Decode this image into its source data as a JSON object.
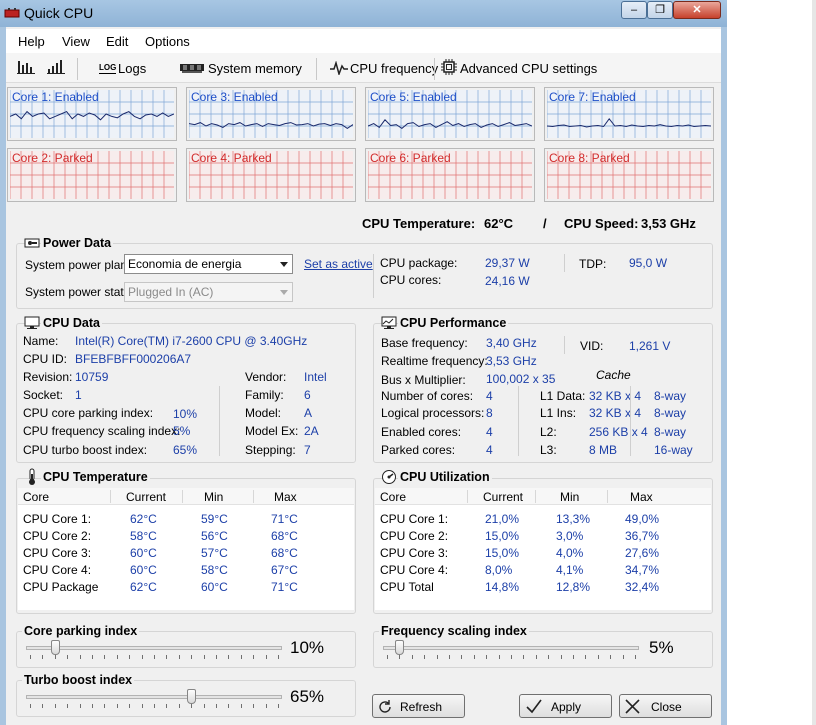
{
  "window": {
    "title": "Quick CPU",
    "controls": {
      "minimize": "‒",
      "maximize": "❐",
      "close": "✕"
    }
  },
  "menu": [
    "Help",
    "View",
    "Edit",
    "Options"
  ],
  "toolbar": {
    "logs": "Logs",
    "system_memory": "System memory",
    "cpu_frequency": "CPU frequency",
    "advanced": "Advanced CPU settings",
    "logs_icon_text": "LOG"
  },
  "cores": [
    {
      "label": "Core 1: Enabled",
      "state": "enabled",
      "series": [
        0.55,
        0.5,
        0.6,
        0.45,
        0.55,
        0.5,
        0.48,
        0.6,
        0.55,
        0.5,
        0.45,
        0.6,
        0.5,
        0.55,
        0.48,
        0.52,
        0.62,
        0.5,
        0.55,
        0.58,
        0.5,
        0.45,
        0.55,
        0.6,
        0.52,
        0.5,
        0.55,
        0.48,
        0.55,
        0.5
      ]
    },
    {
      "label": "Core 3: Enabled",
      "state": "enabled",
      "series": [
        0.7,
        0.72,
        0.68,
        0.75,
        0.7,
        0.73,
        0.78,
        0.7,
        0.72,
        0.68,
        0.75,
        0.72,
        0.7,
        0.76,
        0.7,
        0.72,
        0.74,
        0.7,
        0.68,
        0.73,
        0.72,
        0.7,
        0.75,
        0.71,
        0.7,
        0.74,
        0.7,
        0.72,
        0.8,
        0.72
      ]
    },
    {
      "label": "Core 5: Enabled",
      "state": "enabled",
      "series": [
        0.75,
        0.7,
        0.78,
        0.62,
        0.74,
        0.72,
        0.8,
        0.7,
        0.68,
        0.76,
        0.72,
        0.7,
        0.78,
        0.72,
        0.66,
        0.74,
        0.7,
        0.76,
        0.72,
        0.7,
        0.78,
        0.73,
        0.7,
        0.76,
        0.72,
        0.68,
        0.74,
        0.72,
        0.7,
        0.75
      ]
    },
    {
      "label": "Core 7: Enabled",
      "state": "enabled",
      "series": [
        0.75,
        0.76,
        0.74,
        0.73,
        0.76,
        0.75,
        0.74,
        0.77,
        0.75,
        0.74,
        0.76,
        0.6,
        0.75,
        0.74,
        0.76,
        0.73,
        0.75,
        0.76,
        0.74,
        0.75,
        0.72,
        0.75,
        0.76,
        0.74,
        0.75,
        0.73,
        0.76,
        0.75,
        0.74,
        0.75
      ]
    },
    {
      "label": "Core 2: Parked",
      "state": "parked",
      "series": []
    },
    {
      "label": "Core 4: Parked",
      "state": "parked",
      "series": []
    },
    {
      "label": "Core 6: Parked",
      "state": "parked",
      "series": []
    },
    {
      "label": "Core 8: Parked",
      "state": "parked",
      "series": []
    }
  ],
  "summary": {
    "temp_label": "CPU Temperature:",
    "temp_value": "62°C",
    "slash": "/",
    "speed_label": "CPU Speed:",
    "speed_value": "3,53 GHz"
  },
  "power": {
    "title": "Power Data",
    "plan_label": "System power plan:",
    "plan_value": "Economia de energia",
    "set_active": "Set as active",
    "state_label": "System power state:",
    "state_value": "Plugged In (AC)",
    "package_label": "CPU package:",
    "package_value": "29,37 W",
    "cores_label": "CPU cores:",
    "cores_value": "24,16 W",
    "tdp_label": "TDP:",
    "tdp_value": "95,0 W"
  },
  "cpu_data": {
    "title": "CPU Data",
    "name_label": "Name:",
    "name_value": "Intel(R) Core(TM) i7-2600 CPU @ 3.40GHz",
    "id_label": "CPU ID:",
    "id_value": "BFEBFBFF000206A7",
    "revision_label": "Revision:",
    "revision_value": "10759",
    "socket_label": "Socket:",
    "socket_value": "1",
    "parking_label": "CPU core parking index:",
    "parking_value": "10%",
    "scaling_label": "CPU frequency scaling index:",
    "scaling_value": "5%",
    "turbo_label": "CPU turbo boost index:",
    "turbo_value": "65%",
    "vendor_label": "Vendor:",
    "vendor_value": "Intel",
    "family_label": "Family:",
    "family_value": "6",
    "model_label": "Model:",
    "model_value": "A",
    "modelex_label": "Model Ex:",
    "modelex_value": "2A",
    "stepping_label": "Stepping:",
    "stepping_value": "7"
  },
  "cpu_perf": {
    "title": "CPU Performance",
    "base_label": "Base frequency:",
    "base_value": "3,40 GHz",
    "real_label": "Realtime frequency:",
    "real_value": "3,53 GHz",
    "bus_label": "Bus x Multiplier:",
    "bus_value": "100,002 x 35",
    "num_cores_label": "Number of cores:",
    "num_cores_value": "4",
    "logical_label": "Logical processors:",
    "logical_value": "8",
    "enabled_label": "Enabled cores:",
    "enabled_value": "4",
    "parked_label": "Parked cores:",
    "parked_value": "4",
    "vid_label": "VID:",
    "vid_value": "1,261 V",
    "cache_heading": "Cache",
    "cache": [
      {
        "label": "L1 Data:",
        "size": "32 KB x 4",
        "way": "8-way"
      },
      {
        "label": "L1 Ins:",
        "size": "32 KB x 4",
        "way": "8-way"
      },
      {
        "label": "L2:",
        "size": "256 KB x 4",
        "way": "8-way"
      },
      {
        "label": "L3:",
        "size": "8 MB",
        "way": "16-way"
      }
    ]
  },
  "cpu_temp": {
    "title": "CPU Temperature",
    "headers": [
      "Core",
      "Current",
      "Min",
      "Max"
    ],
    "rows": [
      [
        "CPU Core 1:",
        "62°C",
        "59°C",
        "71°C"
      ],
      [
        "CPU Core 2:",
        "58°C",
        "56°C",
        "68°C"
      ],
      [
        "CPU Core 3:",
        "60°C",
        "57°C",
        "68°C"
      ],
      [
        "CPU Core 4:",
        "60°C",
        "58°C",
        "67°C"
      ],
      [
        "CPU Package",
        "62°C",
        "60°C",
        "71°C"
      ]
    ]
  },
  "cpu_util": {
    "title": "CPU Utilization",
    "headers": [
      "Core",
      "Current",
      "Min",
      "Max"
    ],
    "rows": [
      [
        "CPU Core 1:",
        "21,0%",
        "13,3%",
        "49,0%"
      ],
      [
        "CPU Core 2:",
        "15,0%",
        "3,0%",
        "36,7%"
      ],
      [
        "CPU Core 3:",
        "15,0%",
        "4,0%",
        "27,6%"
      ],
      [
        "CPU Core 4:",
        "8,0%",
        "4,1%",
        "34,7%"
      ],
      [
        "CPU Total",
        "14,8%",
        "12,8%",
        "32,4%"
      ]
    ]
  },
  "sliders": {
    "parking": {
      "title": "Core parking index",
      "value": "10%",
      "fraction": 0.1
    },
    "scaling": {
      "title": "Frequency scaling index",
      "value": "5%",
      "fraction": 0.05
    },
    "turbo": {
      "title": "Turbo boost index",
      "value": "65%",
      "fraction": 0.65
    }
  },
  "buttons": {
    "refresh": "Refresh",
    "apply": "Apply",
    "close": "Close"
  },
  "colors": {
    "enabled_label": "#1d4ec8",
    "parked_label": "#d22b2b",
    "enabled_grid": "#7fa6d6",
    "parked_grid": "#e07070",
    "value_blue": "#1c3fa8"
  }
}
